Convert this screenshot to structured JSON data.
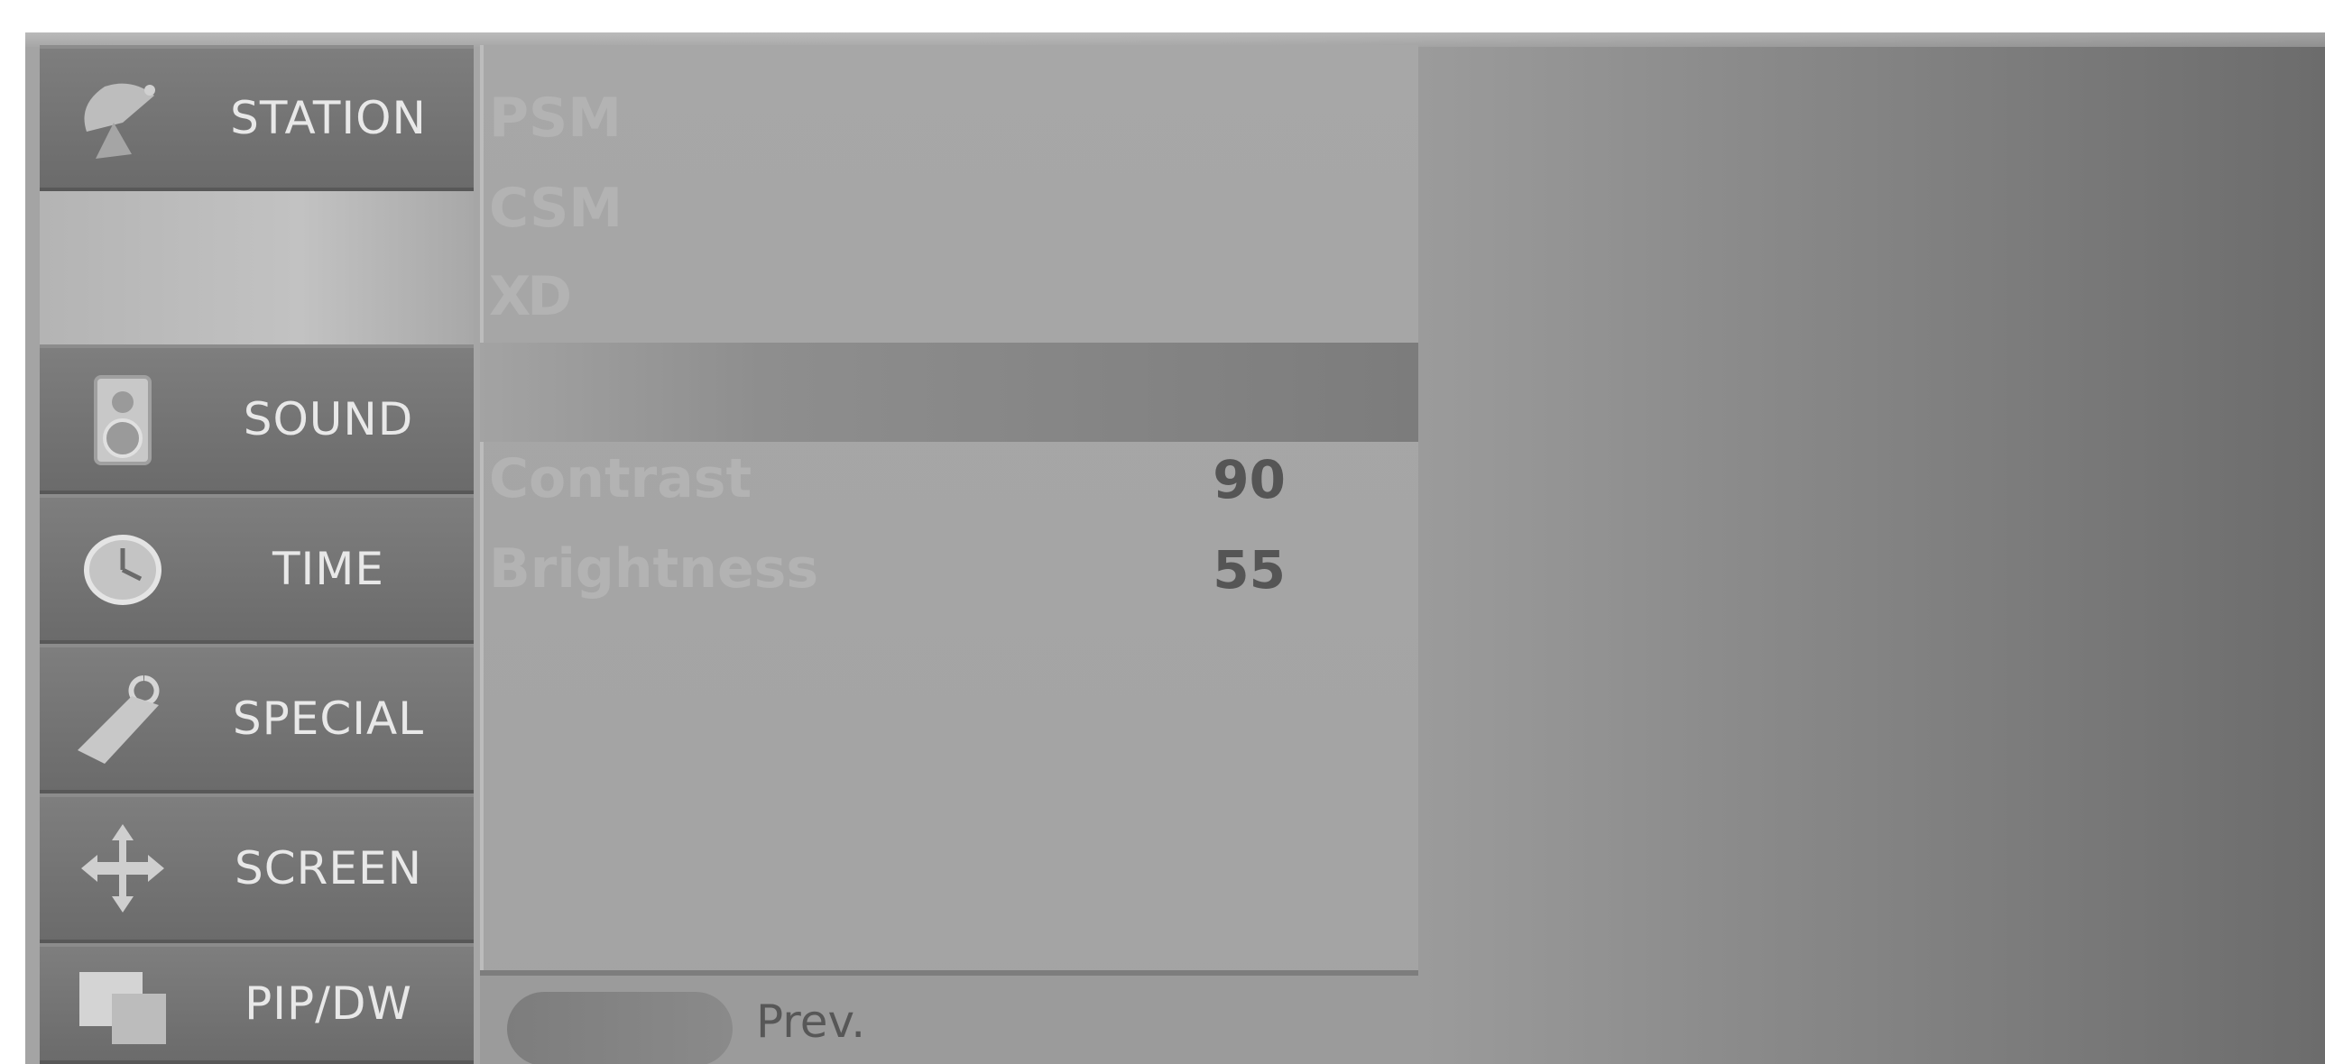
{
  "menu": {
    "items": [
      {
        "label": "STATION",
        "icon": "satellite-dish-icon"
      },
      {
        "label": "SOUND",
        "icon": "speaker-icon"
      },
      {
        "label": "TIME",
        "icon": "clock-icon"
      },
      {
        "label": "SPECIAL",
        "icon": "tag-icon"
      },
      {
        "label": "SCREEN",
        "icon": "move-arrows-icon"
      },
      {
        "label": "PIP/DW",
        "icon": "pip-windows-icon"
      }
    ]
  },
  "submenu": {
    "items": [
      "PSM",
      "CSM",
      "XD"
    ],
    "settings": [
      {
        "label": "Contrast",
        "value": "90"
      },
      {
        "label": "Brightness",
        "value": "55"
      }
    ]
  },
  "footer": {
    "prev_label": "Prev."
  }
}
